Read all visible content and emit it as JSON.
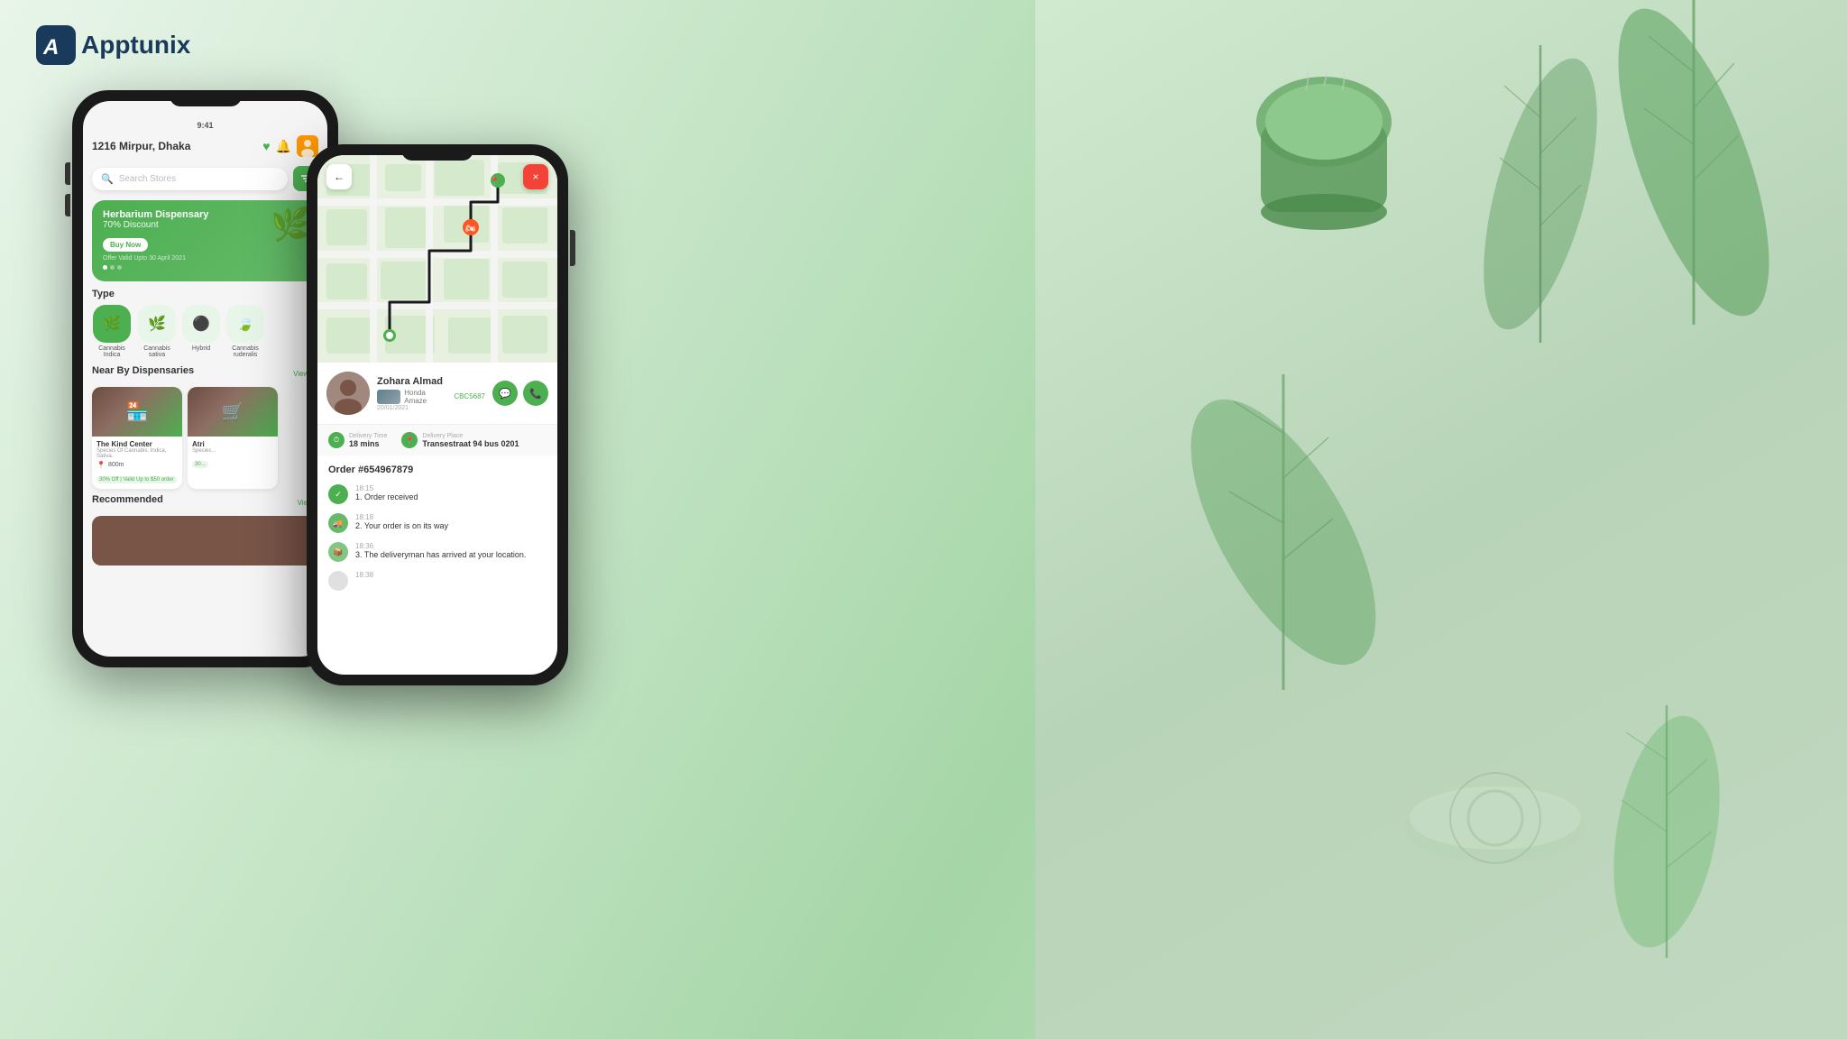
{
  "logo": {
    "brand": "Apptunix",
    "letter": "A"
  },
  "phone1": {
    "location": "1216 Mirpur, Dhaka",
    "search": {
      "placeholder": "Search Stores"
    },
    "banner": {
      "title": "Herbarium Dispensary",
      "discount": "70% Discount",
      "button": "Buy Now",
      "offer_text": "Offer Valid Upto 30 April 2021"
    },
    "type_section": {
      "title": "Type",
      "items": [
        {
          "label": "Cannabis Indica",
          "emoji": "🌿",
          "active": true
        },
        {
          "label": "Cannabis sativa",
          "emoji": "🌿",
          "active": false
        },
        {
          "label": "Hybrid",
          "emoji": "🌑",
          "active": false
        },
        {
          "label": "Cannabis ruderalis",
          "emoji": "🍃",
          "active": false
        }
      ]
    },
    "nearby_section": {
      "title": "Near By Dispensaries",
      "view_all": "View All",
      "items": [
        {
          "name": "The Kind Center",
          "species": "Species Of Cannabis: Indica, Sativa.",
          "distance": "800m",
          "offer": "30% Off | Valid Up to $50 order"
        },
        {
          "name": "Atri",
          "species": "Species...",
          "distance": "",
          "offer": "30..."
        }
      ]
    },
    "recommended_section": {
      "title": "Recommended",
      "view_all": "View..."
    }
  },
  "phone2": {
    "back_button": "←",
    "close_button": "×",
    "driver": {
      "name": "Zohara Almad",
      "car_name": "Honda Amaze",
      "plate": "CBC5687",
      "date": "20/01/2021",
      "chat_icon": "💬",
      "call_icon": "📞"
    },
    "delivery": {
      "time_label": "Delivery Time",
      "time_value": "18 mins",
      "place_label": "Delivery Place",
      "place_value": "Transestraat 94 bus 0201"
    },
    "order": {
      "id": "Order #654967879",
      "tracking": [
        {
          "time": "18:15",
          "text": "1. Order received",
          "status": "done"
        },
        {
          "time": "18:18",
          "text": "2. Your order is on its way",
          "status": "transit"
        },
        {
          "time": "18:36",
          "text": "3. The deliveryman has arrived at your location.",
          "status": "arrived"
        },
        {
          "time": "18:38",
          "text": "",
          "status": "pending"
        }
      ]
    }
  }
}
